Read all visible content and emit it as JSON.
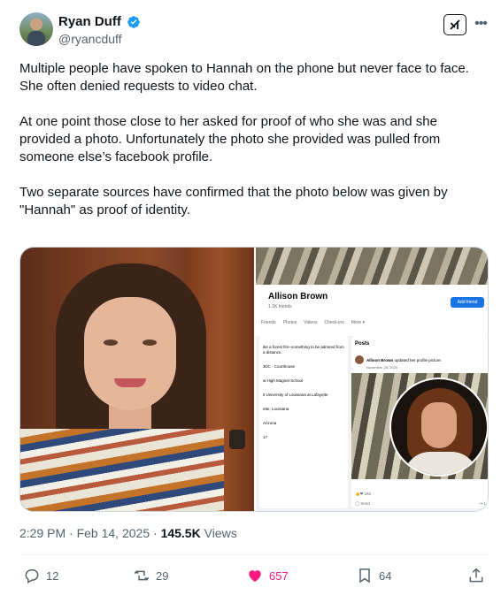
{
  "author": {
    "display_name": "Ryan Duff",
    "handle": "@ryancduff",
    "verified": true,
    "verified_color": "#1d9bf0"
  },
  "header_icons": [
    "grok-icon",
    "more-icon"
  ],
  "tweet": {
    "paragraphs": [
      "Multiple people have spoken to Hannah on the phone but never face to face. She often denied requests to video chat.",
      "At one point those close to her asked for proof of who she was and she provided a photo. Unfortunately the photo she provided was pulled from someone else’s facebook profile.",
      "Two separate sources have confirmed that the photo below was given by \"Hannah\" as proof of identity."
    ]
  },
  "media": {
    "right_screenshot": {
      "profile_name": "Allison Brown",
      "friends": "1.1K friends",
      "add_friend": "Add friend",
      "tabs": [
        "Friends",
        "Photos",
        "Videos",
        "Check-ins",
        "More ▾"
      ],
      "intro_lines": [
        "ike a forest fire–something to be admired from a distance.",
        "JDC - Courthouse",
        "w High Magnet School",
        "it University of Louisiana at Lafayette",
        "ette, Louisiana",
        "Arizona",
        "17"
      ],
      "posts_title": "Posts",
      "post_author": "Allison Brown",
      "post_action": "updated her profile picture.",
      "post_date": "November 25, 2020 · ",
      "reactions": "162",
      "comments_label": "Send",
      "shares_label": "1"
    }
  },
  "meta": {
    "time": "2:29 PM",
    "separator": "·",
    "date": "Feb 14, 2025",
    "views_count": "145.5K",
    "views_label": "Views"
  },
  "actions": {
    "replies": "12",
    "retweets": "29",
    "likes": "657",
    "bookmarks": "64"
  },
  "colors": {
    "like_accent": "#f91880",
    "text_secondary": "#536471",
    "fb_blue": "#1b74e4"
  }
}
